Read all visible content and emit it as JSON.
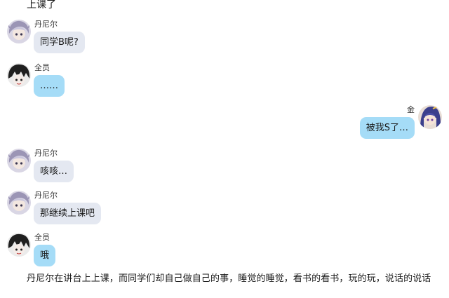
{
  "top_text": "上课了",
  "messages": [
    {
      "sender": "丹尼尔",
      "text": "同学B呢?",
      "side": "left",
      "avatar": "danier-avatar",
      "bubble": "gray"
    },
    {
      "sender": "全员",
      "text": "……",
      "side": "left",
      "avatar": "quanyuan-avatar",
      "bubble": "blue"
    },
    {
      "sender": "金",
      "text": "被我S了…",
      "side": "right",
      "avatar": "jin-avatar",
      "bubble": "blue"
    },
    {
      "sender": "丹尼尔",
      "text": "咳咳…",
      "side": "left",
      "avatar": "danier-avatar",
      "bubble": "gray"
    },
    {
      "sender": "丹尼尔",
      "text": "那继续上课吧",
      "side": "left",
      "avatar": "danier-avatar",
      "bubble": "gray"
    },
    {
      "sender": "全员",
      "text": "哦",
      "side": "left",
      "avatar": "quanyuan-avatar",
      "bubble": "blue"
    }
  ],
  "narration": "丹尼尔在讲台上上课，而同学们却自己做自己的事，睡觉的睡觉，看书的看书，玩的玩，说话的说话",
  "colors": {
    "bubble_gray": "#e4e8f1",
    "bubble_blue": "#a5dcf7",
    "text": "#1a1a1a"
  }
}
